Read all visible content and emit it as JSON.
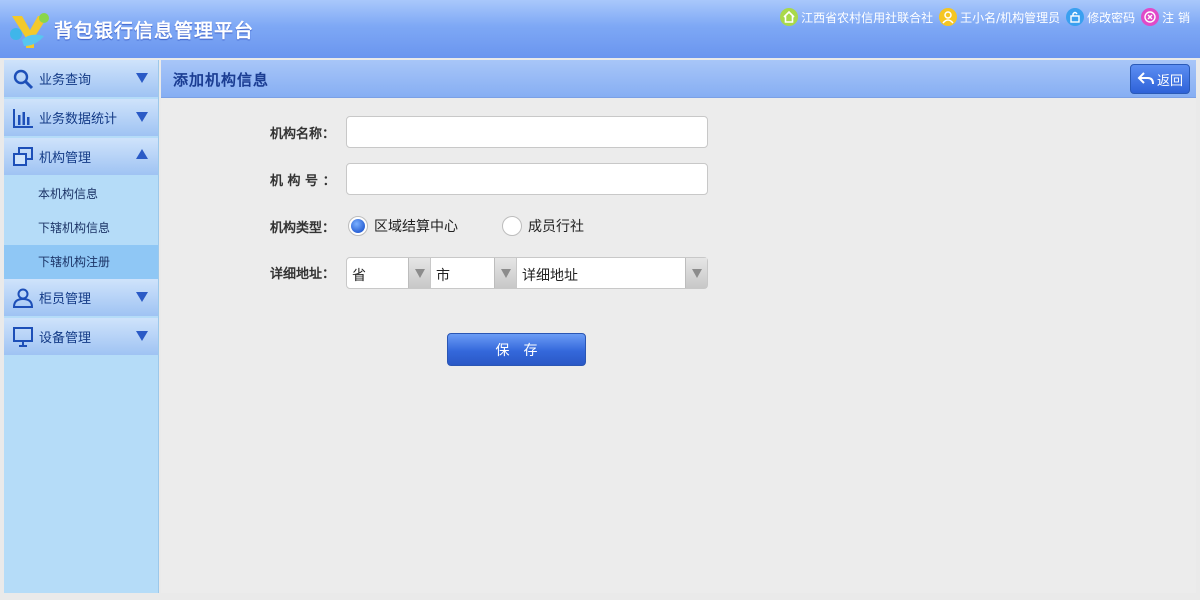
{
  "header": {
    "app_title": "背包银行信息管理平台",
    "org_name": "江西省农村信用社联合社",
    "user_role": "王小名/机构管理员",
    "change_password": "修改密码",
    "logout": "注 销"
  },
  "sidebar": {
    "items": [
      {
        "label": "业务查询",
        "icon": "search-icon",
        "expanded": false
      },
      {
        "label": "业务数据统计",
        "icon": "bar-chart-icon",
        "expanded": false
      },
      {
        "label": "机构管理",
        "icon": "windows-icon",
        "expanded": true,
        "children": [
          {
            "label": "本机构信息",
            "active": false
          },
          {
            "label": "下辖机构信息",
            "active": false
          },
          {
            "label": "下辖机构注册",
            "active": true
          }
        ]
      },
      {
        "label": "柜员管理",
        "icon": "user-icon",
        "expanded": false
      },
      {
        "label": "设备管理",
        "icon": "monitor-icon",
        "expanded": false
      }
    ]
  },
  "main": {
    "page_title": "添加机构信息",
    "back_label": "返回",
    "form": {
      "org_name_label": "机构名称：",
      "org_name_value": "",
      "org_no_label": "机 构 号 ：",
      "org_no_value": "",
      "org_type_label": "机构类型：",
      "org_type_options": [
        "区域结算中心",
        "成员行社"
      ],
      "org_type_selected": "区域结算中心",
      "address_label": "详细地址：",
      "province_value": "省",
      "city_value": "市",
      "address_value": "详细地址",
      "save_label": "保存"
    }
  },
  "colors": {
    "header_blue": "#7ea8f5",
    "sidebar_bg": "#b5dcf8",
    "button_blue": "#3468db"
  }
}
